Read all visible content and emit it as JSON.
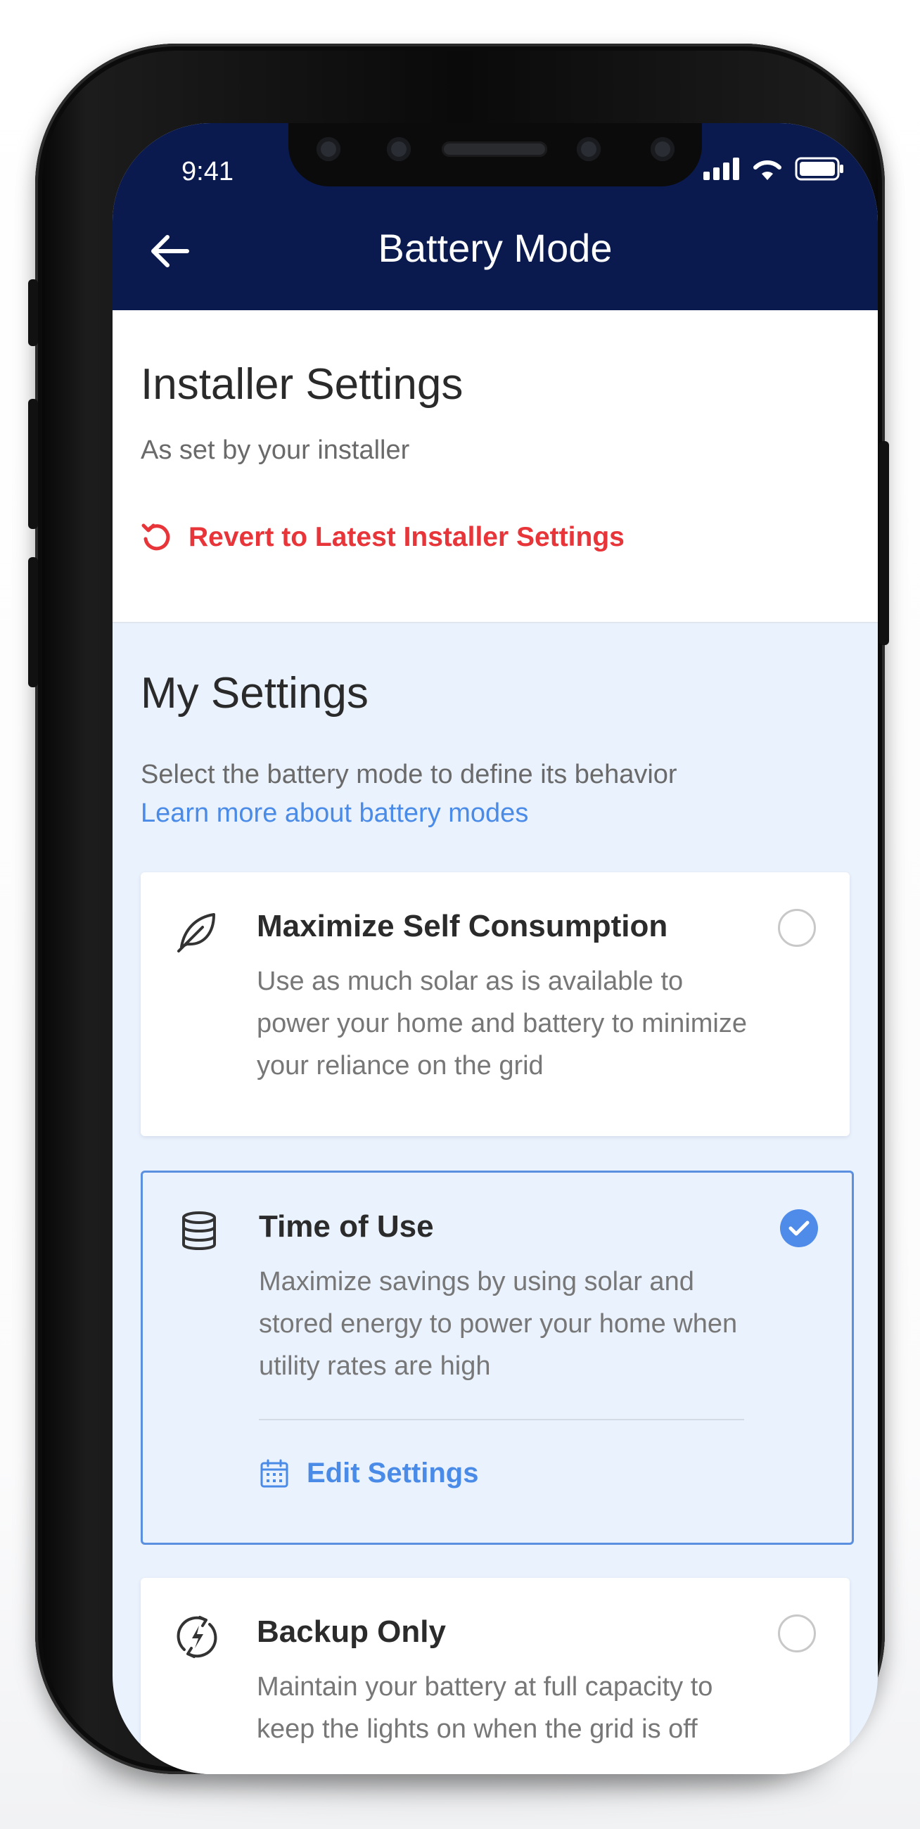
{
  "status_bar": {
    "time": "9:41"
  },
  "header": {
    "title": "Battery Mode"
  },
  "installer": {
    "heading": "Installer Settings",
    "subtitle": "As set by your installer",
    "revert_label": "Revert to Latest Installer Settings"
  },
  "my_settings": {
    "heading": "My Settings",
    "description": "Select the battery mode to define its behavior",
    "learn_more": "Learn more about battery modes"
  },
  "modes": [
    {
      "title": "Maximize Self Consumption",
      "description": "Use as much solar as is available to power your home and battery to minimize your reliance on the grid",
      "icon": "leaf-icon",
      "selected": false
    },
    {
      "title": "Time of Use",
      "description": "Maximize savings by using solar and stored energy to power your home when utility rates are high",
      "icon": "database-icon",
      "selected": true,
      "edit_label": "Edit Settings"
    },
    {
      "title": "Backup Only",
      "description": "Maintain your battery at full capacity to keep the lights on when the grid is off",
      "icon": "power-backup-icon",
      "selected": false
    }
  ],
  "colors": {
    "header_bg": "#0a1a4f",
    "accent_blue": "#4a8be8",
    "revert_red": "#e8353a",
    "settings_bg": "#eaf2fd"
  }
}
